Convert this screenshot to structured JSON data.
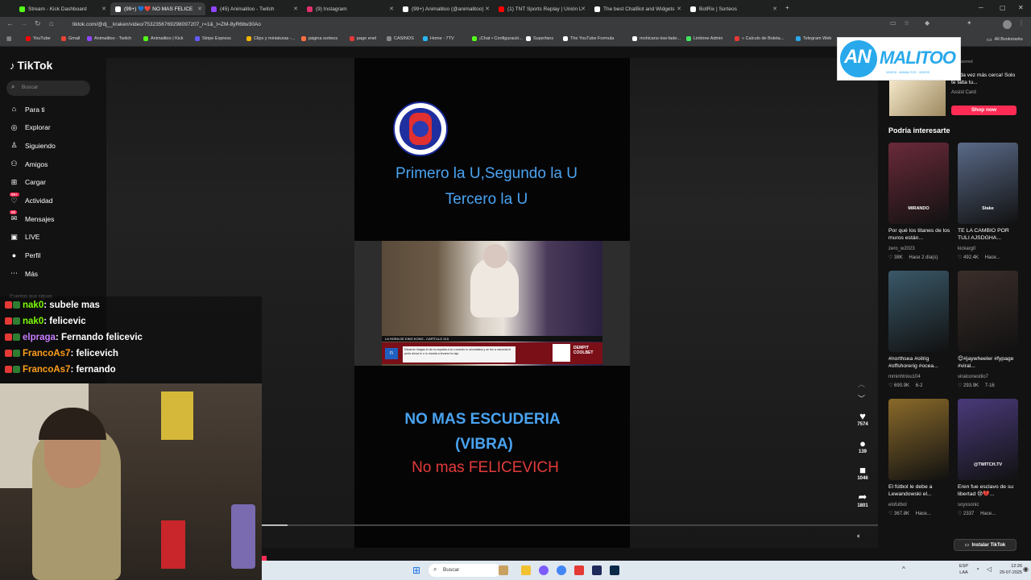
{
  "browser": {
    "tabs": [
      {
        "title": "Stream - Kick Dashboard",
        "color": "#53fc18"
      },
      {
        "title": "(99+) 💙❤️ NO MAS FELICE",
        "color": "#ffffff",
        "active": true
      },
      {
        "title": "(45) Animalitoo - Twitch",
        "color": "#9146ff"
      },
      {
        "title": "(9) Instagram",
        "color": "#e1306c"
      },
      {
        "title": "(99+) Animalitoo (@animalitoo)",
        "color": "#ffffff"
      },
      {
        "title": "(1) TNT Sports Replay | Unión L",
        "color": "#ff0000"
      },
      {
        "title": "The best ChatBot and Widgets",
        "color": "#ffffff"
      },
      {
        "title": "BotRix | Sorteos",
        "color": "#ffffff"
      }
    ],
    "new_tab": "+",
    "url": "tiktok.com/@dj__kraken/video/7532356769298097207_r=1&_t=ZM-8yR6ltw30Ao",
    "bookmarks": [
      {
        "label": "YouTube",
        "color": "#ff0000"
      },
      {
        "label": "Gmail",
        "color": "#ea4335"
      },
      {
        "label": "Animalitoo - Twitch",
        "color": "#9146ff"
      },
      {
        "label": "Animalitoo | Kick",
        "color": "#53fc18"
      },
      {
        "label": "Stripe Express",
        "color": "#635bff"
      },
      {
        "label": "Clips y miniaturas -...",
        "color": "#f4b400"
      },
      {
        "label": "página sorteos",
        "color": "#ff7043"
      },
      {
        "label": "pago enel",
        "color": "#e53935"
      },
      {
        "label": "CASINOS",
        "color": "#888888"
      },
      {
        "label": "Home - 7TV",
        "color": "#29b6f6"
      },
      {
        "label": "¡Chat • Configuració...",
        "color": "#53fc18"
      },
      {
        "label": "Superfans",
        "color": "#ffffff"
      },
      {
        "label": "The YouTube Formula",
        "color": "#ffffff"
      },
      {
        "label": "mohicano-low-fade...",
        "color": "#ffffff"
      },
      {
        "label": "Linktree Admin",
        "color": "#43e660"
      },
      {
        "label": "« Calculo de Boleta...",
        "color": "#e53935"
      },
      {
        "label": "Telegram Web",
        "color": "#29a9eb"
      }
    ],
    "all_bookmarks": "All Bookmarks"
  },
  "tiktok": {
    "logo": "TikTok",
    "search_placeholder": "Buscar",
    "nav": [
      {
        "label": "Para ti",
        "icon": "home-icon",
        "glyph": "⌂"
      },
      {
        "label": "Explorar",
        "icon": "compass-icon",
        "glyph": "◎"
      },
      {
        "label": "Siguiendo",
        "icon": "following-icon",
        "glyph": "♙"
      },
      {
        "label": "Amigos",
        "icon": "friends-icon",
        "glyph": "⚇"
      },
      {
        "label": "Cargar",
        "icon": "upload-icon",
        "glyph": "⊞"
      },
      {
        "label": "Actividad",
        "icon": "activity-icon",
        "glyph": "♡",
        "badge": "99+"
      },
      {
        "label": "Mensajes",
        "icon": "messages-icon",
        "glyph": "✉",
        "badge": "86"
      },
      {
        "label": "LIVE",
        "icon": "live-icon",
        "glyph": "▣"
      },
      {
        "label": "Perfil",
        "icon": "profile-icon",
        "glyph": "●"
      },
      {
        "label": "Más",
        "icon": "more-icon",
        "glyph": "⋯"
      }
    ],
    "following_heading": "Cuentas que sigues",
    "video": {
      "text_top_line1": "Primero la U,Segundo la U",
      "text_top_line2": "Tercero la U",
      "text_bottom_line1": "NO MAS ESCUDERIA",
      "text_bottom_line2": "(VIBRA)",
      "text_bottom_line3": "No mas FELICEVICH",
      "clip_caption": "LA HORA DE KING KONG - CAPÍTULO 315",
      "clip_ticker": "Eduardo Vargas le dio la espalda a la u cuando lo necesitaba y se fue a nacional el perla ahora le u lo manda a levarse la raja",
      "clip_brand": "DEMPIT COOLBET"
    },
    "actions": [
      {
        "icon": "heart-icon",
        "glyph": "♥",
        "count": "7574"
      },
      {
        "icon": "comment-icon",
        "glyph": "●",
        "count": "139"
      },
      {
        "icon": "bookmark-icon",
        "glyph": "■",
        "count": "1046"
      },
      {
        "icon": "share-icon",
        "glyph": "➦",
        "count": "1801"
      }
    ],
    "sponsored": {
      "label": "Sponsored",
      "text": "¡Cada vez más cerca! Solo te falta tu...",
      "advertiser": "Assist Card",
      "cta": "Shop now"
    },
    "interest_heading": "Podría interesarte",
    "cards": [
      {
        "title": "Por qué los titanes de los muros están...",
        "user": "zero_w2023",
        "likes": "38K",
        "time": "Hace 2 día(s)",
        "thumb_text": "MIRANDO",
        "color": "#6a2a3a"
      },
      {
        "title": "TE LA CAMBIO POR TULI AJSDGHA...",
        "user": "kickarg0",
        "likes": "492.4K",
        "time": "Hace...",
        "thumb_text": "Stake",
        "color": "#5a6a88"
      },
      {
        "title": "#northsea #oilrig #offshorerig #ocea...",
        "user": "mminhtriou104",
        "likes": "690.9K",
        "time": "6-2",
        "thumb_text": "",
        "color": "#3a5868"
      },
      {
        "title": "😊#jaywheeler #fypage #viral...",
        "user": "viralconestilo7",
        "likes": "293.9K",
        "time": "7-16",
        "thumb_text": "",
        "color": "#3b2e2a"
      },
      {
        "title": "El fútbol le debe a Lewandowski el...",
        "user": "elofutbol",
        "likes": "367.8K",
        "time": "Hace...",
        "thumb_text": "",
        "color": "#8a6a2a"
      },
      {
        "title": "Eren fue esclavo de su libertad 😢💔...",
        "user": "soyxsonic",
        "likes": "2337",
        "time": "Hace...",
        "thumb_text": "@TWITCH.TV",
        "color": "#4a3a7a"
      }
    ],
    "install_button": "Instalar TikTok"
  },
  "overlay": {
    "logo_text": "ANIMALITOO",
    "logo_sub": "VIDEOS · ANIMALITOO · VIDEOS",
    "logo_color": "#29a9eb",
    "chat": [
      {
        "user": "nak0",
        "text": "subele mas",
        "color": "#7cfc00"
      },
      {
        "user": "nak0",
        "text": "felicevic",
        "color": "#7cfc00"
      },
      {
        "user": "elpraga",
        "text": "Fernando felicevic",
        "color": "#c87dff"
      },
      {
        "user": "FrancoAs7",
        "text": "felicevich",
        "color": "#ff9f1a"
      },
      {
        "user": "FrancoAs7",
        "text": "fernando",
        "color": "#ff9f1a"
      }
    ]
  },
  "taskbar": {
    "search": "Buscar",
    "lang": "ESP",
    "lang2": "LAA",
    "time": "12:26",
    "date": "29-07-2025"
  }
}
